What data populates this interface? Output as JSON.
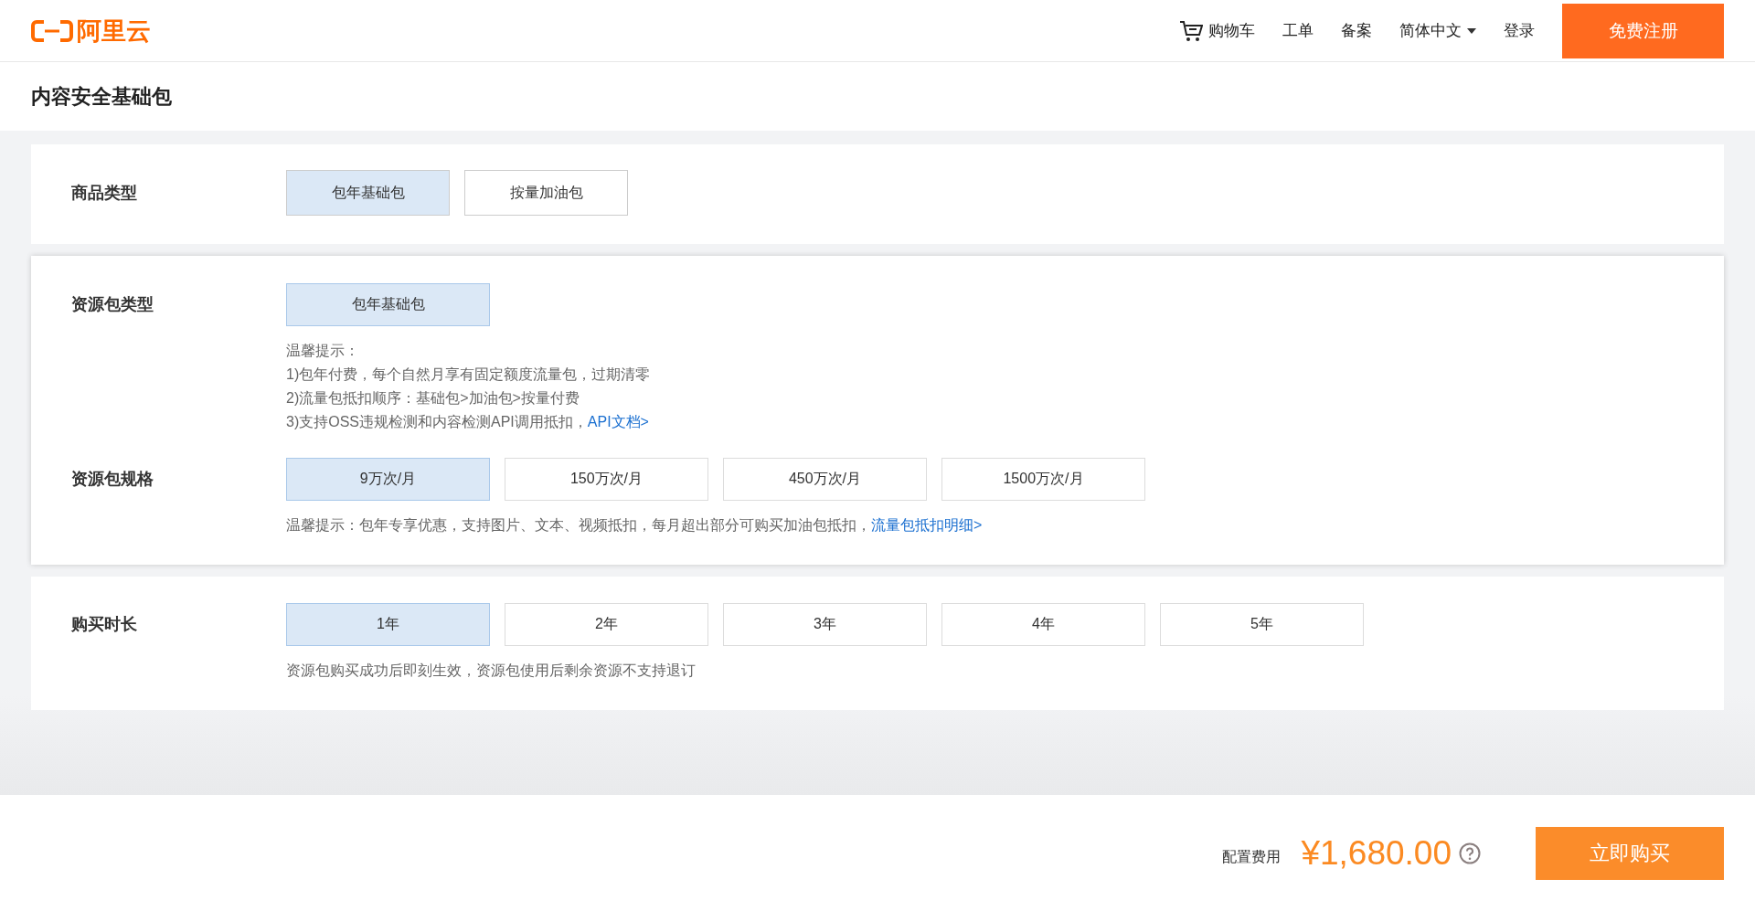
{
  "header": {
    "logo": "阿里云",
    "nav": [
      {
        "kind": "cart",
        "label": "购物车"
      },
      {
        "kind": "link",
        "label": "工单"
      },
      {
        "kind": "link",
        "label": "备案"
      },
      {
        "kind": "dropdown",
        "label": "简体中文"
      },
      {
        "kind": "link",
        "label": "登录"
      }
    ],
    "register_button": "免费注册"
  },
  "page_title": "内容安全基础包",
  "sections": [
    {
      "rows": [
        {
          "label": "商品类型",
          "options": [
            {
              "label": "包年基础包",
              "selected": true
            },
            {
              "label": "按量加油包",
              "selected": false
            }
          ]
        }
      ]
    },
    {
      "rows": [
        {
          "label": "资源包类型",
          "options": [
            {
              "label": "包年基础包",
              "selected": true
            }
          ],
          "notes": [
            {
              "text": "温馨提示："
            },
            {
              "text": "1)包年付费，每个自然月享有固定额度流量包，过期清零"
            },
            {
              "text": "2)流量包抵扣顺序：基础包>加油包>按量付费"
            },
            {
              "text": "3)支持OSS违规检测和内容检测API调用抵扣，",
              "link": "API文档>"
            }
          ]
        },
        {
          "label": "资源包规格",
          "options": [
            {
              "label": "9万次/月",
              "selected": true
            },
            {
              "label": "150万次/月",
              "selected": false
            },
            {
              "label": "450万次/月",
              "selected": false
            },
            {
              "label": "1500万次/月",
              "selected": false
            }
          ],
          "notes": [
            {
              "text": "温馨提示：包年专享优惠，支持图片、文本、视频抵扣，每月超出部分可购买加油包抵扣，",
              "link": "流量包抵扣明细>"
            }
          ]
        }
      ]
    },
    {
      "rows": [
        {
          "label": "购买时长",
          "options": [
            {
              "label": "1年",
              "selected": true
            },
            {
              "label": "2年",
              "selected": false
            },
            {
              "label": "3年",
              "selected": false
            },
            {
              "label": "4年",
              "selected": false
            },
            {
              "label": "5年",
              "selected": false
            }
          ],
          "notes": [
            {
              "text": "资源包购买成功后即刻生效，资源包使用后剩余资源不支持退订"
            }
          ]
        }
      ]
    }
  ],
  "footer": {
    "price_label": "配置费用",
    "price": "¥1,680.00",
    "buy_button": "立即购买"
  }
}
